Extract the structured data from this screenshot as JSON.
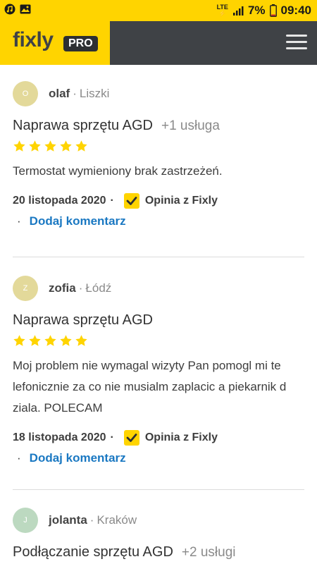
{
  "status_bar": {
    "left_icons": [
      "music-icon",
      "image-icon"
    ],
    "network": "LTE",
    "battery": "7%",
    "time": "09:40"
  },
  "header": {
    "logo": "fixly",
    "badge": "PRO",
    "menu_icon": "menu-icon"
  },
  "reviews": [
    {
      "initial": "O",
      "avatar_color": "#e3d99a",
      "name": "olaf",
      "separator": "·",
      "city": "Liszki",
      "service": "Naprawa sprzętu AGD",
      "extra": "+1 usługa",
      "stars": 5,
      "text": "Termostat wymieniony brak zastrzeżeń.",
      "date": "20 listopada 2020",
      "source": "Opinia z Fixly",
      "comment_link": "Dodaj komentarz"
    },
    {
      "initial": "Z",
      "avatar_color": "#e3d99a",
      "name": "zofia",
      "separator": "·",
      "city": "Łódź",
      "service": "Naprawa sprzętu AGD",
      "extra": "",
      "stars": 5,
      "text": "Moj problem nie wymagal wizyty Pan pomogl mi te lefonicznie za co nie musialm zaplacic a piekarnik d ziala. POLECAM",
      "date": "18 listopada 2020",
      "source": "Opinia z Fixly",
      "comment_link": "Dodaj komentarz"
    },
    {
      "initial": "J",
      "avatar_color": "#bcd9c0",
      "name": "jolanta",
      "separator": "·",
      "city": "Kraków",
      "service": "Podłączanie sprzętu AGD",
      "extra": "+2 usługi"
    }
  ],
  "colors": {
    "brand_yellow": "#ffd400",
    "header_dark": "#3f4246",
    "link_blue": "#1a78c2",
    "star": "#ffd400"
  }
}
